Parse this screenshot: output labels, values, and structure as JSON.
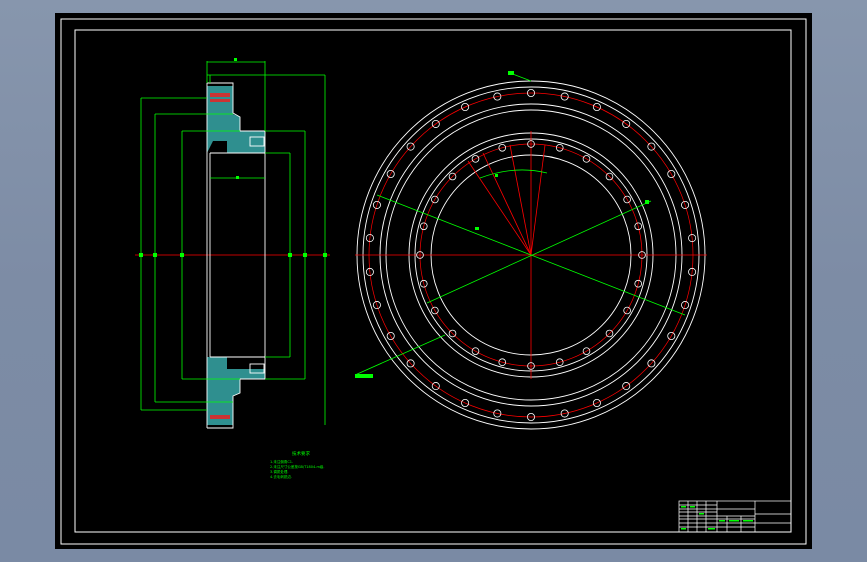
{
  "colors": {
    "background": "#000000",
    "outline": "#ffffff",
    "dimension": "#00ff00",
    "centerline": "#ff0000",
    "section_fill": "#2f8f8f",
    "frame_surround": "#8090a8"
  },
  "tech_notes": {
    "title": "技术要求",
    "lines": [
      "1.未注倒角C1.",
      "2.未注尺寸公差按GB/T1804-m级.",
      "3.调质处理.",
      "4.去毛刺锐边."
    ]
  },
  "title_block": {
    "cells": []
  },
  "labels": {
    "hole_callout": "φ",
    "angle_callout": "",
    "bolt_hole_callout": "φ"
  }
}
